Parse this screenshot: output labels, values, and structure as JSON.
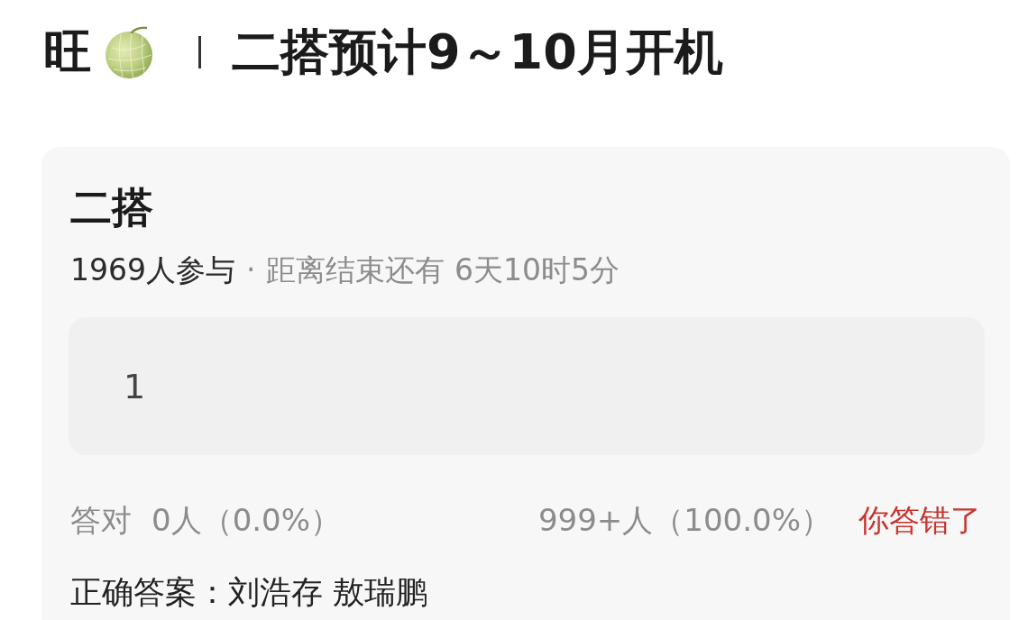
{
  "post": {
    "title_prefix": "旺",
    "title": "二搭预计9～10月开机"
  },
  "quiz": {
    "title": "二搭",
    "participants": "1969人参与",
    "separator": "·",
    "countdown": "距离结束还有 6天10时5分",
    "answer": "1",
    "results": {
      "correct_label": "答对",
      "correct_count": "0人（0.0%）",
      "wrong_count": "999+人（100.0%）",
      "verdict": "你答错了",
      "verdict_correct": false
    },
    "correct_answer": "正确答案：刘浩存 敖瑞鹏"
  }
}
